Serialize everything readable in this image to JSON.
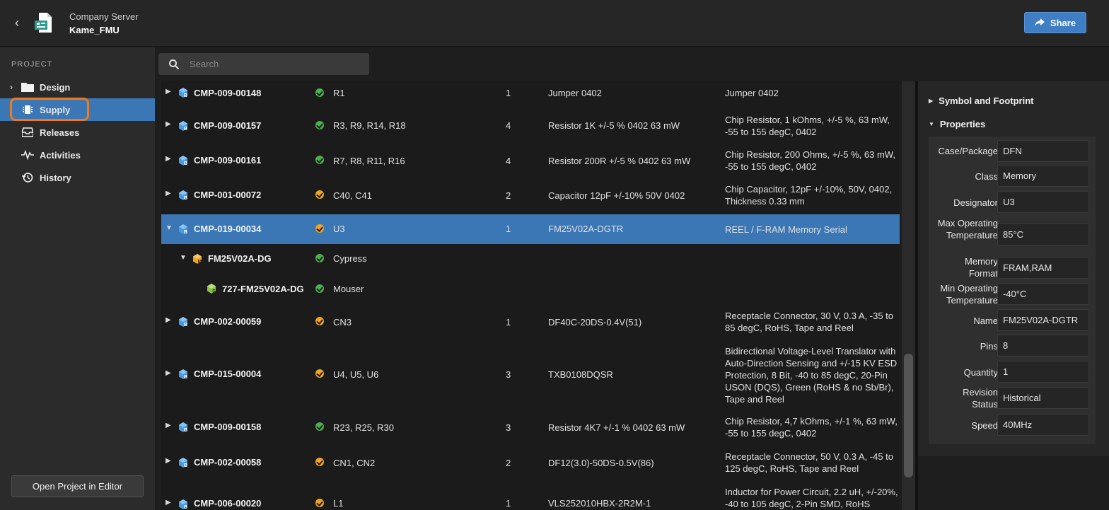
{
  "header": {
    "server": "Company Server",
    "project": "Kame_FMU",
    "share_label": "Share"
  },
  "sidebar": {
    "heading": "PROJECT",
    "items": [
      {
        "label": "Design",
        "icon": "folder-icon"
      },
      {
        "label": "Supply",
        "icon": "chip-icon",
        "active": true
      },
      {
        "label": "Releases",
        "icon": "inbox-icon"
      },
      {
        "label": "Activities",
        "icon": "pulse-icon"
      },
      {
        "label": "History",
        "icon": "history-icon"
      }
    ],
    "open_button": "Open Project in Editor"
  },
  "search": {
    "placeholder": "Search"
  },
  "table": {
    "rows": [
      {
        "pn": "CMP-009-00148",
        "status": "ok",
        "desig": "R1",
        "qty": "1",
        "comment": "Jumper 0402",
        "desc": "Jumper 0402"
      },
      {
        "pn": "CMP-009-00157",
        "status": "ok",
        "desig": "R3, R9, R14, R18",
        "qty": "4",
        "comment": "Resistor 1K +/-5 % 0402 63 mW",
        "desc": "Chip Resistor, 1 kOhms, +/-5 %, 63 mW, -55 to 155 degC, 0402"
      },
      {
        "pn": "CMP-009-00161",
        "status": "ok",
        "desig": "R7, R8, R11, R16",
        "qty": "4",
        "comment": "Resistor 200R +/-5 % 0402 63 mW",
        "desc": "Chip Resistor, 200 Ohms, +/-5 %, 63 mW, -55 to 155 degC, 0402"
      },
      {
        "pn": "CMP-001-00072",
        "status": "warn",
        "desig": "C40, C41",
        "qty": "2",
        "comment": "Capacitor 12pF +/-10% 50V 0402",
        "desc": "Chip Capacitor, 12pF +/-10%, 50V, 0402, Thickness 0.33 mm"
      },
      {
        "pn": "CMP-019-00034",
        "status": "warn",
        "desig": "U3",
        "qty": "1",
        "comment": "FM25V02A-DGTR",
        "desc": "REEL / F-RAM Memory Serial"
      },
      {
        "pn": "FM25V02A-DG",
        "status": "ok",
        "desig": "Cypress",
        "qty": "",
        "comment": "",
        "desc": ""
      },
      {
        "pn": "727-FM25V02A-DG",
        "status": "ok",
        "desig": "Mouser",
        "qty": "",
        "comment": "",
        "desc": ""
      },
      {
        "pn": "CMP-002-00059",
        "status": "warn",
        "desig": "CN3",
        "qty": "1",
        "comment": "DF40C-20DS-0.4V(51)",
        "desc": "Receptacle Connector, 30 V, 0.3 A, -35 to 85 degC, RoHS, Tape and Reel"
      },
      {
        "pn": "CMP-015-00004",
        "status": "warn",
        "desig": "U4, U5, U6",
        "qty": "3",
        "comment": "TXB0108DQSR",
        "desc": "Bidirectional Voltage-Level Translator with Auto-Direction Sensing and +/-15 KV ESD Protection, 8 Bit, -40 to 85 degC, 20-Pin USON (DQS), Green (RoHS & no Sb/Br), Tape and Reel"
      },
      {
        "pn": "CMP-009-00158",
        "status": "ok",
        "desig": "R23, R25, R30",
        "qty": "3",
        "comment": "Resistor 4K7 +/-1 % 0402 63 mW",
        "desc": "Chip Resistor, 4,7 kOhms, +/-1 %, 63 mW, -55 to 155 degC, 0402"
      },
      {
        "pn": "CMP-002-00058",
        "status": "warn",
        "desig": "CN1, CN2",
        "qty": "2",
        "comment": "DF12(3.0)-50DS-0.5V(86)",
        "desc": "Receptacle Connector, 50 V, 0.3 A, -45 to 125 degC, RoHS, Tape and Reel"
      },
      {
        "pn": "CMP-006-00020",
        "status": "warn",
        "desig": "L1",
        "qty": "1",
        "comment": "VLS252010HBX-2R2M-1",
        "desc": "Inductor for Power Circuit, 2.2 uH, +/-20%, -40 to 105 degC, 2-Pin SMD, RoHS"
      }
    ]
  },
  "panel": {
    "section1": "Symbol and Footprint",
    "section2": "Properties",
    "props": [
      {
        "label": "Case/Package",
        "value": "DFN"
      },
      {
        "label": "Class",
        "value": "Memory"
      },
      {
        "label": "Designator",
        "value": "U3"
      },
      {
        "label": "Max Operating Temperature",
        "value": "85°C"
      },
      {
        "label": "Memory Format",
        "value": "FRAM,RAM"
      },
      {
        "label": "Min Operating Temperature",
        "value": "-40°C"
      },
      {
        "label": "Name",
        "value": "FM25V02A-DGTR"
      },
      {
        "label": "Pins",
        "value": "8"
      },
      {
        "label": "Quantity",
        "value": "1"
      },
      {
        "label": "Revision Status",
        "value": "Historical"
      },
      {
        "label": "Speed",
        "value": "40MHz"
      }
    ]
  },
  "colors": {
    "accent": "#3b77b5",
    "ok": "#4caf50",
    "warn": "#f0a520",
    "highlight_ring": "#f07a1a"
  }
}
